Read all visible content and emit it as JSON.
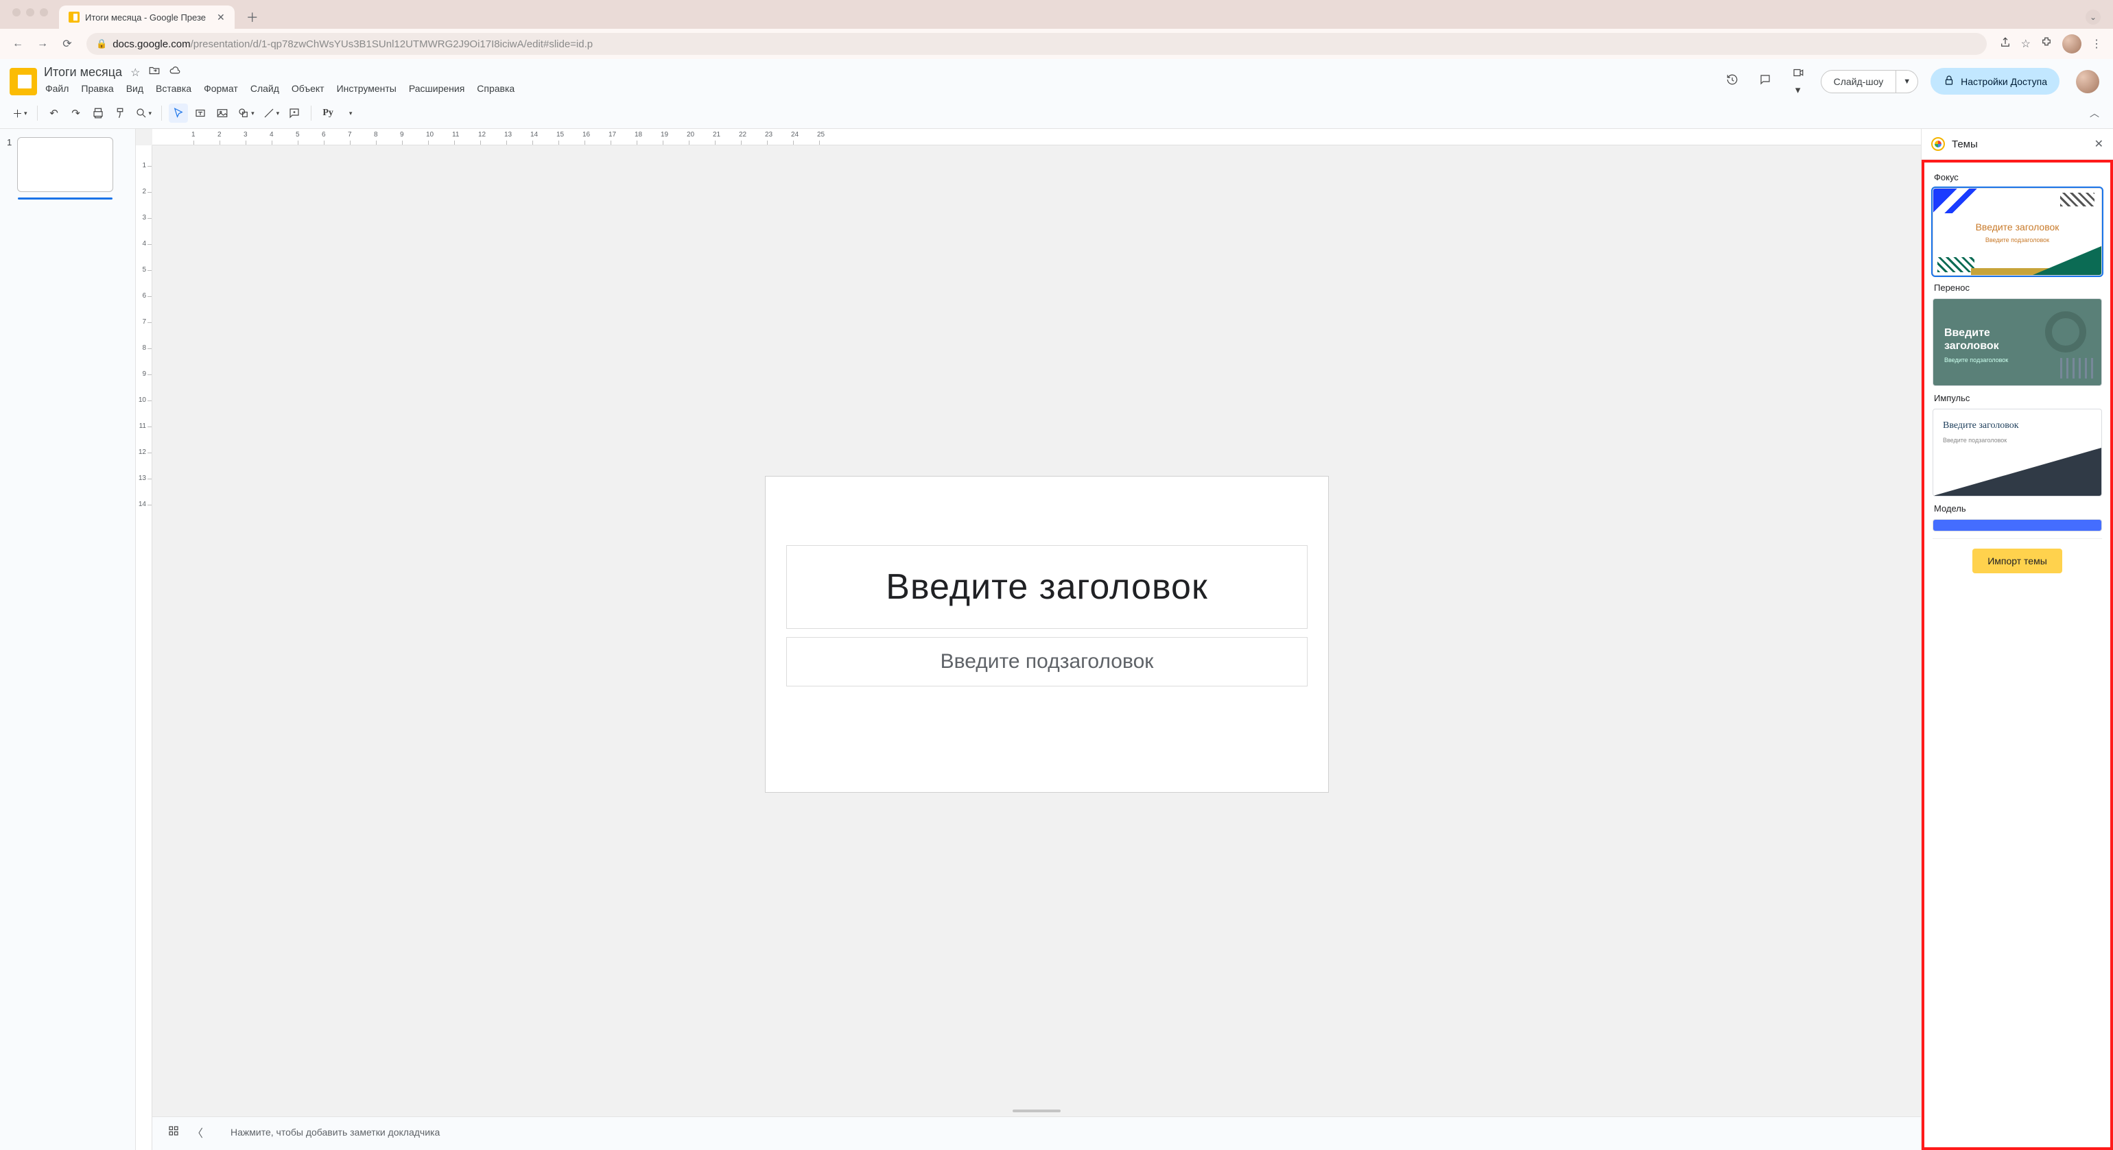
{
  "browser": {
    "tab_title": "Итоги месяца - Google Презе",
    "url_host": "docs.google.com",
    "url_path": "/presentation/d/1-qp78zwChWsYUs3B1SUnl12UTMWRG2J9Oi17I8iciwA/edit#slide=id.p"
  },
  "app": {
    "doc_title": "Итоги месяца",
    "menus": [
      "Файл",
      "Правка",
      "Вид",
      "Вставка",
      "Формат",
      "Слайд",
      "Объект",
      "Инструменты",
      "Расширения",
      "Справка"
    ],
    "slideshow_label": "Слайд-шоу",
    "share_label": "Настройки Доступа"
  },
  "toolbar": {
    "font_label": "Рy"
  },
  "filmstrip": {
    "slides": [
      {
        "number": "1"
      }
    ]
  },
  "canvas": {
    "title_placeholder": "Введите заголовок",
    "subtitle_placeholder": "Введите подзаголовок"
  },
  "ruler_h": [
    "1",
    "2",
    "3",
    "4",
    "5",
    "6",
    "7",
    "8",
    "9",
    "10",
    "11",
    "12",
    "13",
    "14",
    "15",
    "16",
    "17",
    "18",
    "19",
    "20",
    "21",
    "22",
    "23",
    "24",
    "25"
  ],
  "ruler_v": [
    "1",
    "2",
    "3",
    "4",
    "5",
    "6",
    "7",
    "8",
    "9",
    "10",
    "11",
    "12",
    "13",
    "14"
  ],
  "notes": {
    "placeholder": "Нажмите, чтобы добавить заметки докладчика"
  },
  "themes_panel": {
    "title": "Темы",
    "items": [
      {
        "name": "Фокус",
        "card_title": "Введите заголовок",
        "card_sub": "Введите подзаголовок",
        "selected": true
      },
      {
        "name": "Перенос",
        "card_title": "Введите заголовок",
        "card_sub": "Введите подзаголовок"
      },
      {
        "name": "Импульс",
        "card_title": "Введите заголовок",
        "card_sub": "Введите подзаголовок"
      },
      {
        "name": "Модель"
      }
    ],
    "import_label": "Импорт темы"
  }
}
